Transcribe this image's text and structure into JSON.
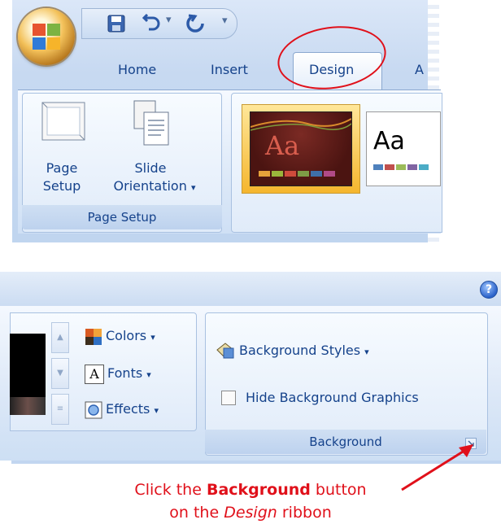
{
  "top": {
    "tabs": [
      "Home",
      "Insert",
      "Design",
      "A"
    ],
    "active_tab": "Design",
    "page_setup_group": {
      "page_setup_label_1": "Page",
      "page_setup_label_2": "Setup",
      "slide_orientation_label_1": "Slide",
      "slide_orientation_label_2": "Orientation",
      "dropdown_glyph": "▾",
      "group_label": "Page Setup"
    },
    "themes": {
      "theme_1_text": "Aa",
      "theme_2_text": "Aa"
    }
  },
  "bottom": {
    "help_glyph": "?",
    "theme_commands": {
      "colors": "Colors",
      "fonts": "Fonts",
      "fonts_icon_letter": "A",
      "effects": "Effects",
      "dropdown_glyph": "▾"
    },
    "background_group": {
      "background_styles": "Background Styles",
      "dropdown_glyph": "▾",
      "hide_background_graphics": "Hide Background Graphics",
      "group_label": "Background"
    }
  },
  "caption": {
    "line1_prefix": "Click the ",
    "line1_bold": "Background",
    "line1_suffix": " button",
    "line2_prefix": "on the ",
    "line2_italic": "Design",
    "line2_suffix": " ribbon"
  },
  "colors": {
    "accent_red": "#e0101a",
    "ribbon_text": "#15428b"
  },
  "icons": [
    "office-button-icon",
    "save-icon",
    "undo-icon",
    "redo-icon",
    "customize-qat-icon",
    "page-setup-icon",
    "slide-orientation-icon",
    "colors-icon",
    "fonts-icon",
    "effects-icon",
    "background-styles-icon",
    "dialog-launcher-icon",
    "help-icon",
    "annotation-arrow-icon"
  ]
}
